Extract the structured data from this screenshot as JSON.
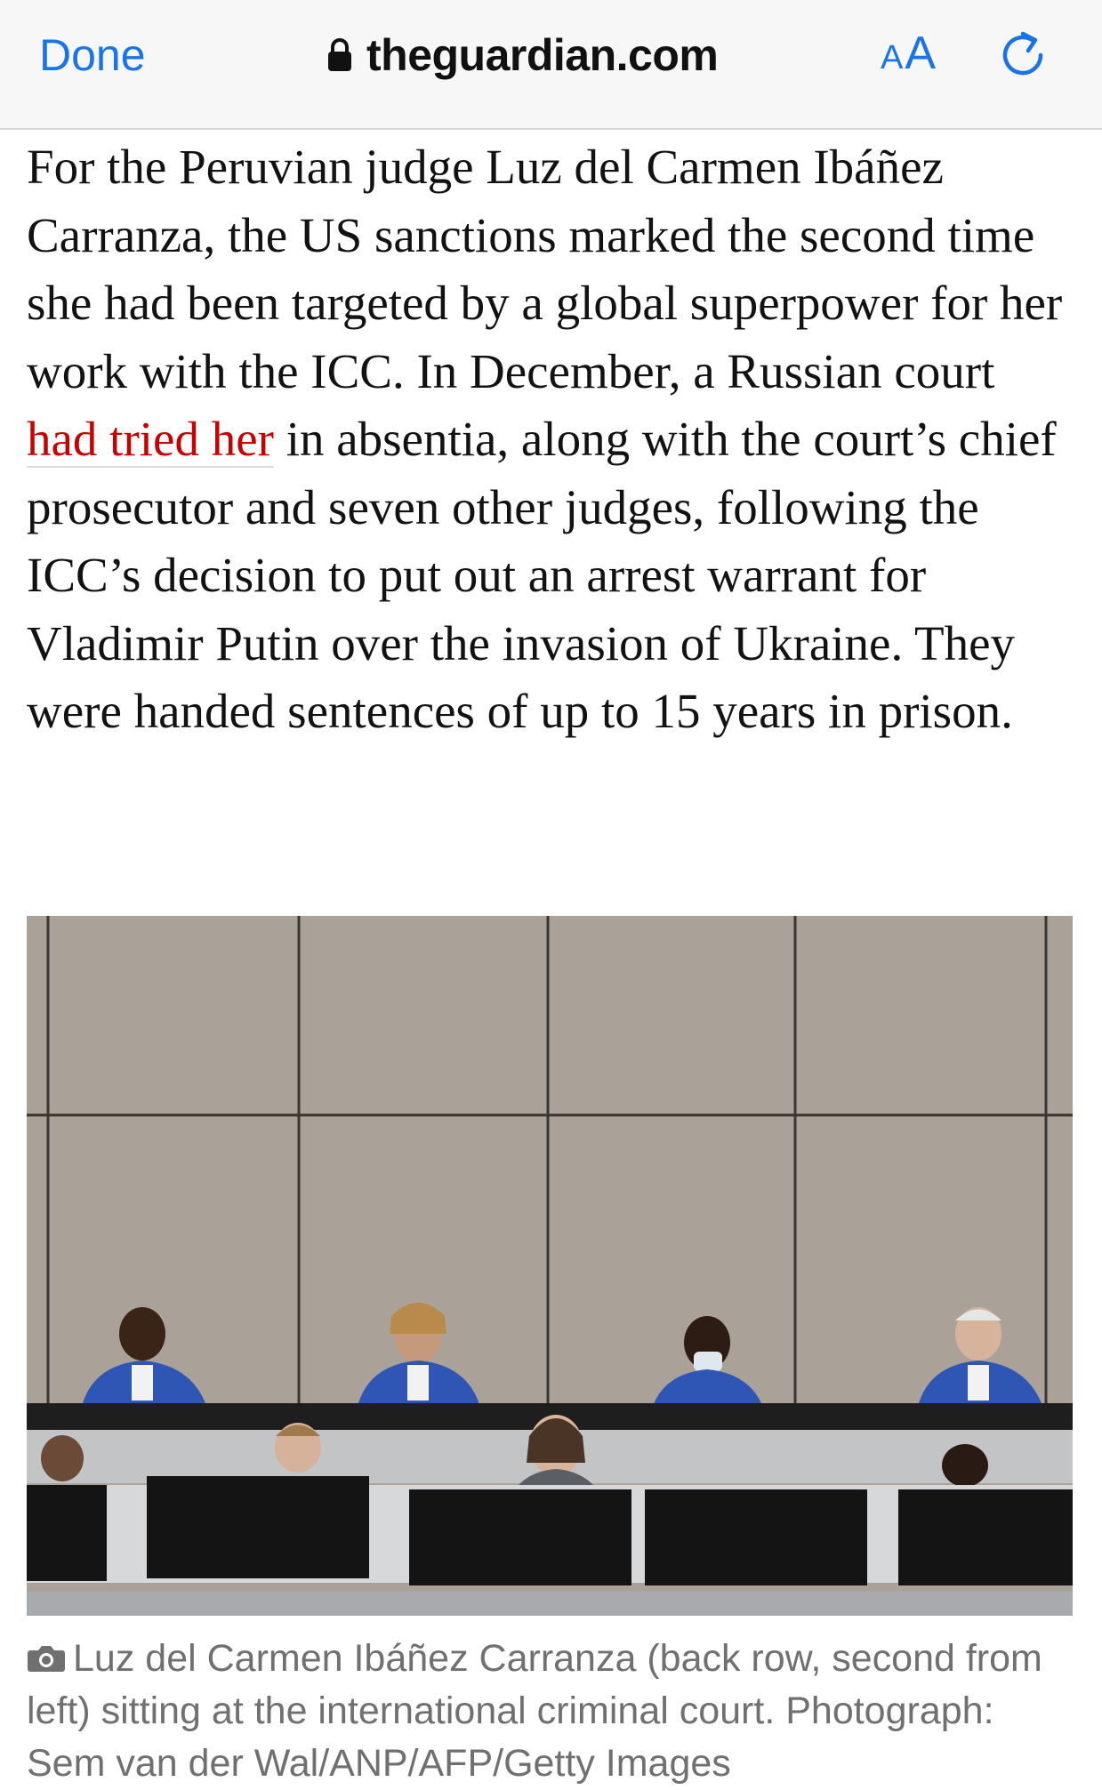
{
  "browser": {
    "done_label": "Done",
    "url": "theguardian.com",
    "text_size_small": "A",
    "text_size_large": "A",
    "accent_color": "#1a73e8",
    "icons": {
      "lock": "lock-icon",
      "reload": "reload-icon"
    }
  },
  "article": {
    "paragraph_before_link": "For the Peruvian judge Luz del Carmen Ibáñez Carranza, the US sanctions marked the second time she had been targeted by a global superpower for her work with the ICC. In December, a Russian court ",
    "link_text": "had tried her",
    "paragraph_after_link": " in absentia, along with the court’s chief prosecutor and seven other judges, following the ICC’s decision to put out an arrest warrant for Vladimir Putin over the invasion of Ukraine. They were handed sentences of up to 15 years in prison.",
    "link_color": "#c70000"
  },
  "photo": {
    "caption": "Luz del Carmen Ibáñez Carranza (back row, second from left) sitting at the international criminal court. Photograph: Sem van der Wal/ANP/AFP/Getty Images",
    "caption_icon": "camera-icon"
  }
}
